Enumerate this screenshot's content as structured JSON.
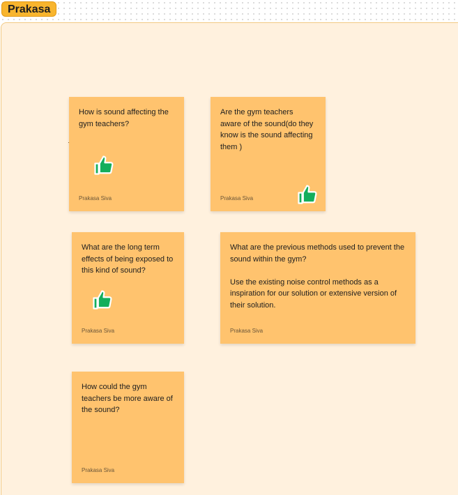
{
  "section": {
    "title": "Prakasa"
  },
  "stickies": [
    {
      "text": "How is sound affecting the gym teachers?",
      "author": "Prakasa Siva",
      "reaction": "thumbs-up-icon"
    },
    {
      "text": "Are the gym teachers aware of the sound(do they know is the sound affecting them )",
      "author": "Prakasa Siva",
      "reaction": "thumbs-up-icon"
    },
    {
      "text": "What are the long term effects of being exposed to this kind of sound?",
      "author": "Prakasa Siva",
      "reaction": "thumbs-up-icon"
    },
    {
      "text": "What are the previous methods used to prevent the sound within the gym?\n\nUse the existing noise control methods as a inspiration for our solution or extensive version of their solution.",
      "author": "Prakasa Siva"
    },
    {
      "text": "How could the gym teachers be more aware of the sound?",
      "author": "Prakasa Siva"
    }
  ],
  "colors": {
    "sticky": "#ffc36e",
    "section_background": "#fff1de",
    "section_label": "#f8b52e",
    "thumb": "#14ae5c"
  }
}
